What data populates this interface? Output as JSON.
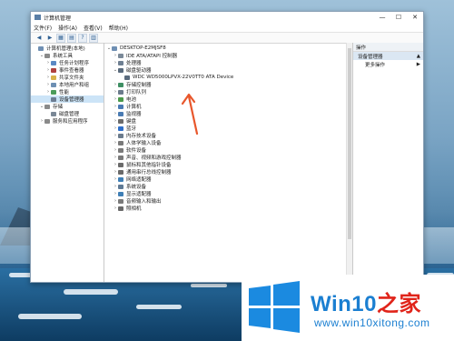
{
  "window": {
    "title": "计算机管理",
    "controls": [
      "—",
      "☐",
      "✕"
    ]
  },
  "menubar": [
    "文件(F)",
    "操作(A)",
    "查看(V)",
    "帮助(H)"
  ],
  "toolbar": [
    "◀",
    "▶",
    "▦",
    "▤",
    "?",
    "▥"
  ],
  "left_tree": [
    {
      "label": "计算机管理(本地)",
      "indent": 0,
      "exp": "",
      "icon": "#6f8fb3"
    },
    {
      "label": "系统工具",
      "indent": 1,
      "exp": "⌄",
      "icon": "#8a8a8a"
    },
    {
      "label": "任务计划程序",
      "indent": 2,
      "exp": "›",
      "icon": "#5b89c4"
    },
    {
      "label": "事件查看器",
      "indent": 2,
      "exp": "›",
      "icon": "#b0413e"
    },
    {
      "label": "共享文件夹",
      "indent": 2,
      "exp": "›",
      "icon": "#d8b24a"
    },
    {
      "label": "本地用户和组",
      "indent": 2,
      "exp": "›",
      "icon": "#6d8fb3"
    },
    {
      "label": "性能",
      "indent": 2,
      "exp": "›",
      "icon": "#4c9c5a"
    },
    {
      "label": "设备管理器",
      "indent": 2,
      "exp": "",
      "icon": "#6c7d92",
      "selected": true
    },
    {
      "label": "存储",
      "indent": 1,
      "exp": "⌄",
      "icon": "#8a8a8a"
    },
    {
      "label": "磁盘管理",
      "indent": 2,
      "exp": "",
      "icon": "#7a8896"
    },
    {
      "label": "服务和应用程序",
      "indent": 1,
      "exp": "›",
      "icon": "#8a8a8a"
    }
  ],
  "device_tree": [
    {
      "label": "DESKTOP-E2MJSF8",
      "indent": 0,
      "exp": "⌄",
      "icon": "#6f8fb3"
    },
    {
      "label": "IDE ATA/ATAPI 控制器",
      "indent": 1,
      "exp": "›",
      "icon": "#7b8a99"
    },
    {
      "label": "处理器",
      "indent": 1,
      "exp": "›",
      "icon": "#6e7f92"
    },
    {
      "label": "磁盘驱动器",
      "indent": 1,
      "exp": "⌄",
      "icon": "#5a6b7d"
    },
    {
      "label": "WDC WD5000LPVX-22V0TT0 ATA Device",
      "indent": 2,
      "exp": "",
      "icon": "#5a6b7d"
    },
    {
      "label": "存储控制器",
      "indent": 1,
      "exp": "›",
      "icon": "#3e8f63"
    },
    {
      "label": "打印队列",
      "indent": 1,
      "exp": "›",
      "icon": "#6b7b8c"
    },
    {
      "label": "电池",
      "indent": 1,
      "exp": "›",
      "icon": "#4b9a4b"
    },
    {
      "label": "计算机",
      "indent": 1,
      "exp": "›",
      "icon": "#4a7bb3"
    },
    {
      "label": "监视器",
      "indent": 1,
      "exp": "›",
      "icon": "#4a7bb3"
    },
    {
      "label": "键盘",
      "indent": 1,
      "exp": "›",
      "icon": "#6b6b6b"
    },
    {
      "label": "蓝牙",
      "indent": 1,
      "exp": "›",
      "icon": "#2f6fc9"
    },
    {
      "label": "内存技术设备",
      "indent": 1,
      "exp": "›",
      "icon": "#6b7b8c"
    },
    {
      "label": "人体学输入设备",
      "indent": 1,
      "exp": "›",
      "icon": "#7a7a7a"
    },
    {
      "label": "软件设备",
      "indent": 1,
      "exp": "›",
      "icon": "#7a7a7a"
    },
    {
      "label": "声音、视频和游戏控制器",
      "indent": 1,
      "exp": "›",
      "icon": "#7a7a7a"
    },
    {
      "label": "鼠标和其他指针设备",
      "indent": 1,
      "exp": "›",
      "icon": "#6a6a6a"
    },
    {
      "label": "通用串行总线控制器",
      "indent": 1,
      "exp": "›",
      "icon": "#6a6a6a"
    },
    {
      "label": "网络适配器",
      "indent": 1,
      "exp": "›",
      "icon": "#3f7fb6"
    },
    {
      "label": "系统设备",
      "indent": 1,
      "exp": "›",
      "icon": "#5f7a95"
    },
    {
      "label": "显示适配器",
      "indent": 1,
      "exp": "›",
      "icon": "#3f7fb6"
    },
    {
      "label": "音频输入和输出",
      "indent": 1,
      "exp": "›",
      "icon": "#7a7a7a"
    },
    {
      "label": "照相机",
      "indent": 1,
      "exp": "›",
      "icon": "#6a6a6a"
    }
  ],
  "actions": {
    "header": "操作",
    "section": "设备管理器",
    "item": "更多操作"
  },
  "logo": {
    "brand": "Win10",
    "brand_cn": "之家",
    "url": "www.win10xitong.com"
  }
}
